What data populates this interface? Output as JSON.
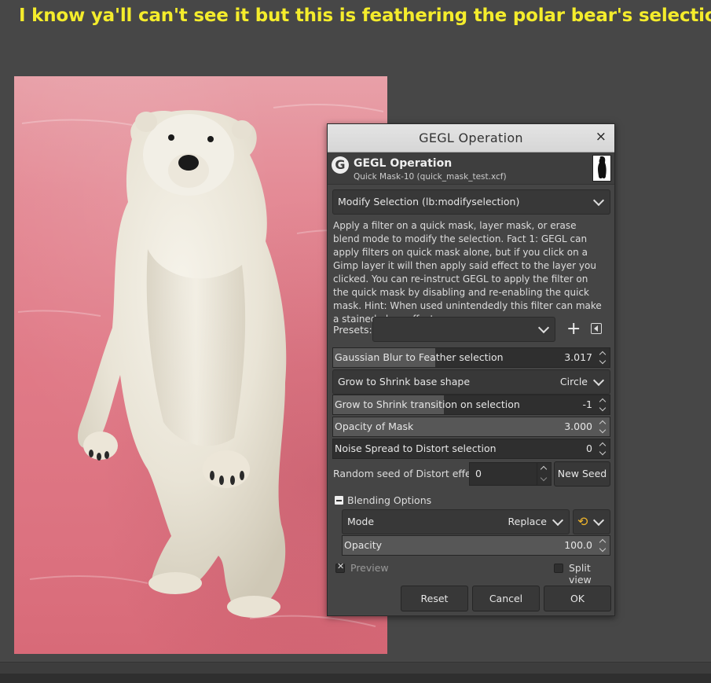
{
  "caption": "I know ya'll can't see it but this is feathering the polar bear's selection.",
  "dialog": {
    "title": "GEGL Operation",
    "close_glyph": "×",
    "header_title": "GEGL Operation",
    "header_subtitle": "Quick Mask-10 (quick_mask_test.xcf)",
    "operation": "Modify Selection (lb:modifyselection)",
    "description": "Apply a filter on a quick mask, layer mask, or erase blend mode to modify the selection. Fact 1: GEGL can apply filters on quick mask alone, but if you click on a Gimp layer it will then apply said effect to the layer you clicked. You can re-instruct GEGL to apply the filter on the quick mask by disabling and re-enabling the quick mask. Hint: When used unintendedly this filter can make a stained glass effect.",
    "presets_label": "Presets:",
    "presets_value": "",
    "add_glyph": "+",
    "params": {
      "gaussian": {
        "label": "Gaussian Blur to Feather selection",
        "value": "3.017",
        "fill": 0.37
      },
      "shape": {
        "label": "Grow to Shrink base shape",
        "value": "Circle"
      },
      "grow": {
        "label": "Grow to Shrink transition on selection",
        "value": "-1",
        "fill": 0.4
      },
      "opacity_mask": {
        "label": "Opacity of Mask",
        "value": "3.000",
        "fill": 1.0
      },
      "noise": {
        "label": "Noise Spread to Distort selection",
        "value": "0",
        "fill": 0.0
      },
      "seed": {
        "label": "Random seed of Distort effect",
        "value": "0"
      },
      "new_seed": "New Seed"
    },
    "blending": {
      "label": "Blending Options",
      "mode_label": "Mode",
      "mode_value": "Replace",
      "opacity_label": "Opacity",
      "opacity_value": "100.0",
      "opacity_fill": 1.0
    },
    "preview_label": "Preview",
    "split_label": "Split view",
    "buttons": {
      "reset": "Reset",
      "cancel": "Cancel",
      "ok": "OK"
    }
  }
}
